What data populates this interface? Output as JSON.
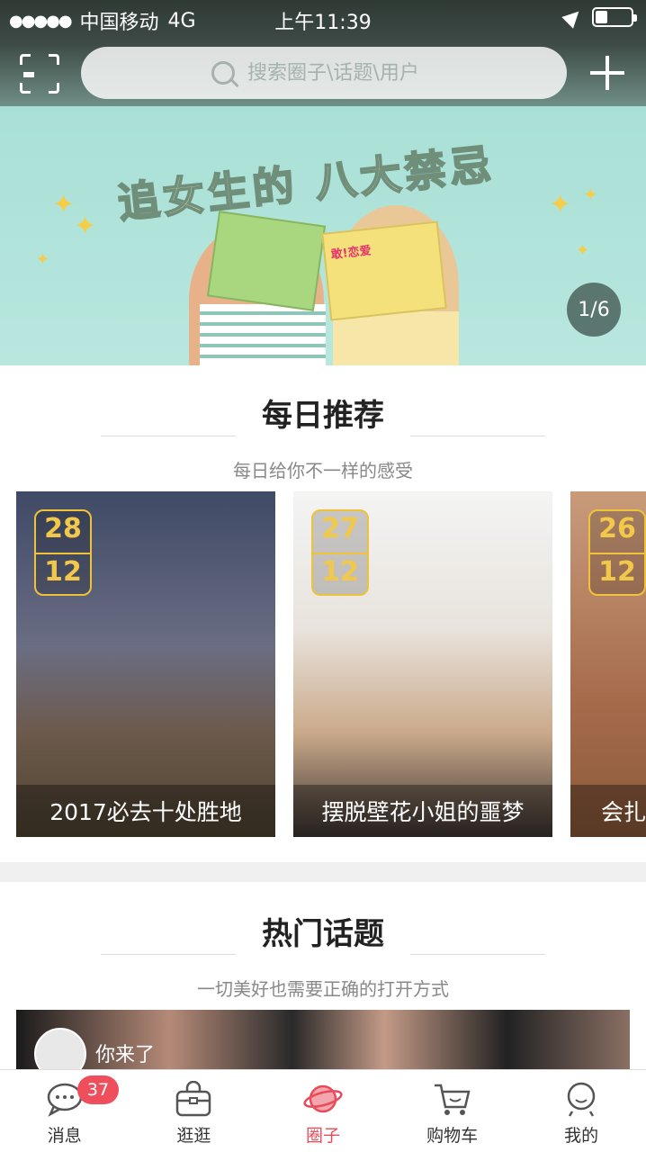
{
  "status_bar": {
    "signal_dots": "●●●●●",
    "carrier": "中国移动",
    "network": "4G",
    "time": "上午11:39",
    "battery_level": 0.35
  },
  "header": {
    "search_placeholder": "搜索圈子\\话题\\用户",
    "scan_icon": "scan-icon",
    "add_icon": "plus-icon"
  },
  "banner": {
    "title": "追女生的 八大禁忌",
    "book_label": "敢!恋爱",
    "page_indicator": "1/6"
  },
  "daily": {
    "title": "每日推荐",
    "subtitle": "每日给你不一样的感受",
    "cards": [
      {
        "day": "28",
        "month": "12",
        "caption": "2017必去十处胜地"
      },
      {
        "day": "27",
        "month": "12",
        "caption": "摆脱壁花小姐的噩梦"
      },
      {
        "day": "26",
        "month": "12",
        "caption": "会扎"
      }
    ]
  },
  "hot": {
    "title": "热门话题",
    "subtitle": "一切美好也需要正确的打开方式",
    "user_text": "你来了"
  },
  "tabbar": {
    "tabs": [
      {
        "label": "消息",
        "badge": "37",
        "icon": "message-icon"
      },
      {
        "label": "逛逛",
        "icon": "bag-icon"
      },
      {
        "label": "圈子",
        "icon": "planet-icon",
        "active": true
      },
      {
        "label": "购物车",
        "icon": "cart-icon"
      },
      {
        "label": "我的",
        "icon": "profile-icon"
      }
    ],
    "active_color": "#e84b5a",
    "badge_color": "#ef4f5d"
  }
}
